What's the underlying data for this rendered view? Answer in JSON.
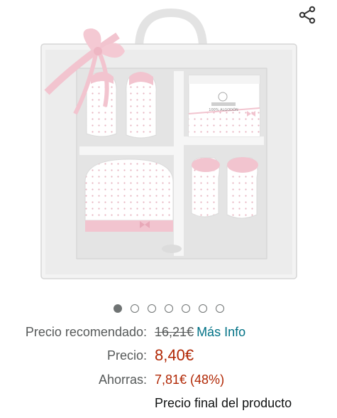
{
  "toolbar": {
    "share_icon": "share-icon"
  },
  "product": {
    "image_label": "100% ALGODÓN",
    "carousel": {
      "total": 7,
      "active_index": 0
    }
  },
  "pricing": {
    "recommended_label": "Precio recomendado:",
    "recommended_value": "16,21€",
    "more_info_link": "Más Info",
    "price_label": "Precio:",
    "price_value": "8,40€",
    "savings_label": "Ahorras:",
    "savings_value": "7,81€ (48%)",
    "final_note": "Precio final del producto"
  },
  "colors": {
    "price_red": "#b12704",
    "link_teal": "#007185",
    "label_gray": "#565959",
    "ribbon_pink": "#f2c4cf"
  }
}
